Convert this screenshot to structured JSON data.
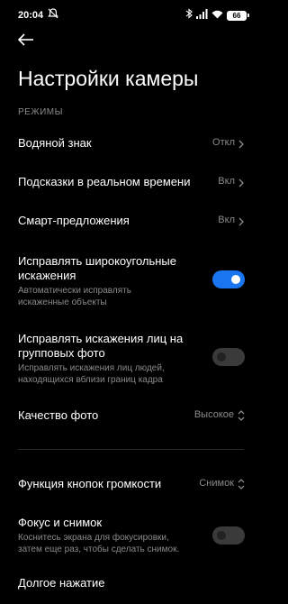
{
  "status_bar": {
    "time": "20:04",
    "battery": "66",
    "icons": [
      "do-not-disturb-icon",
      "bluetooth-icon",
      "signal-icon",
      "wifi-icon",
      "battery-icon"
    ]
  },
  "header": {
    "title": "Настройки камеры",
    "back_icon": "back-arrow-icon"
  },
  "section_label": "РЕЖИМЫ",
  "settings": {
    "watermark": {
      "title": "Водяной знак",
      "value": "Откл"
    },
    "realtime_hints": {
      "title": "Подсказки в реальном времени",
      "value": "Вкл"
    },
    "smart_suggestions": {
      "title": "Смарт-предложения",
      "value": "Вкл"
    },
    "wide_angle": {
      "title_line1": "Исправлять широкоугольные",
      "title_line2": "искажения",
      "desc_line1": "Автоматически исправлять",
      "desc_line2": "искаженные объекты",
      "enabled": true
    },
    "group_faces": {
      "title_line1": "Исправлять искажения лиц на",
      "title_line2": "групповых фото",
      "desc_line1": "Исправлять искажения лиц людей,",
      "desc_line2": "находящихся вблизи границ кадра",
      "enabled": false
    },
    "photo_quality": {
      "title": "Качество фото",
      "value": "Высокое"
    },
    "volume_buttons": {
      "title": "Функция кнопок громкости",
      "value": "Снимок"
    },
    "focus_shoot": {
      "title": "Фокус и снимок",
      "desc_line1": "Коснитесь экрана для фокусировки,",
      "desc_line2": "затем еще раз, чтобы сделать снимок.",
      "enabled": false
    },
    "long_press": {
      "title": "Долгое нажатие"
    }
  },
  "colors": {
    "background": "#000000",
    "accent": "#1976f0",
    "secondary_text": "#8a8a8a",
    "toggle_off": "#3a3a3a"
  }
}
